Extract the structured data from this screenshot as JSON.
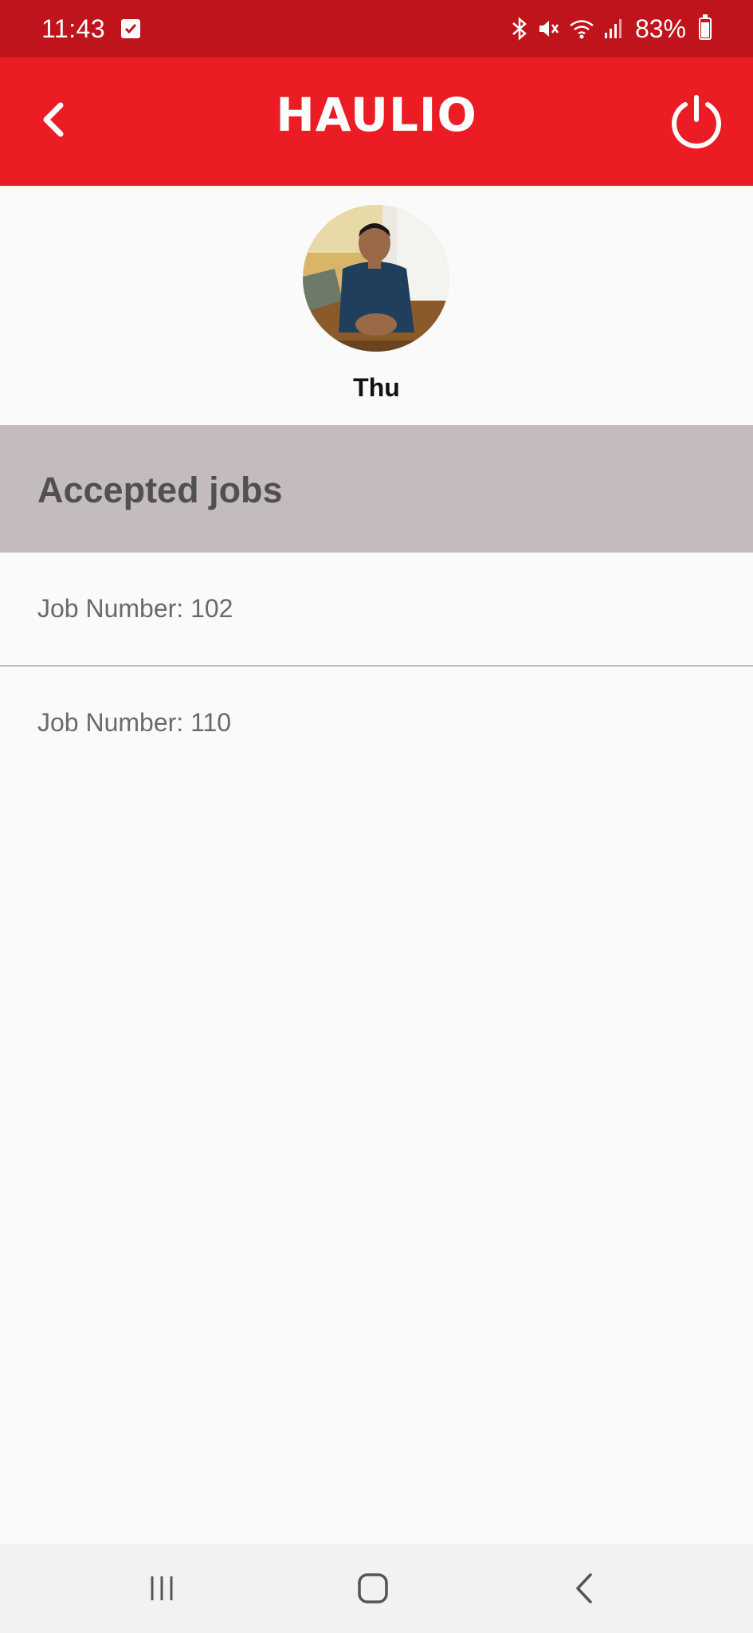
{
  "status_bar": {
    "time": "11:43",
    "battery_percent": "83%",
    "icons": [
      "checkbox-notification-icon",
      "bluetooth-icon",
      "mute-icon",
      "wifi-icon",
      "signal-icon",
      "battery-icon"
    ]
  },
  "app_bar": {
    "logo": "HAULIO",
    "background_color": "#ec1c24",
    "back_icon": "chevron-left-icon",
    "power_icon": "power-icon"
  },
  "profile": {
    "name": "Thu",
    "avatar_icon": "user-avatar-photo"
  },
  "section": {
    "title": "Accepted jobs"
  },
  "jobs": [
    {
      "label": "Job Number: 102"
    },
    {
      "label": "Job Number: 110"
    }
  ],
  "nav_bar": {
    "icons": [
      "recent-apps-icon",
      "home-icon",
      "system-back-icon"
    ]
  }
}
